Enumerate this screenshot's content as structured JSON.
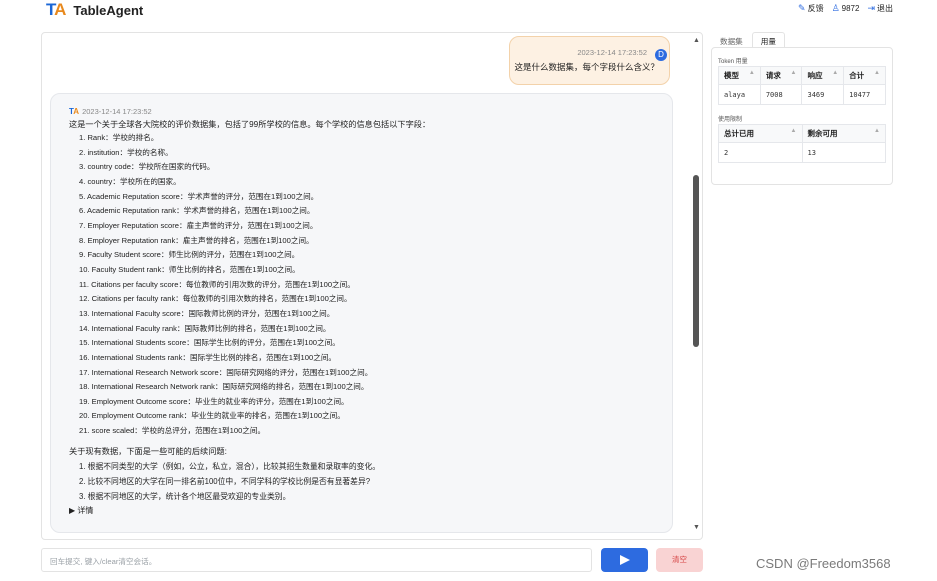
{
  "header": {
    "logo_mark": "TA",
    "app_name": "TableAgent",
    "actions": [
      {
        "label": "反馈",
        "icon": "feedback-icon"
      },
      {
        "label": "9872",
        "icon": "user-points-icon"
      },
      {
        "label": "退出",
        "icon": "logout-icon"
      }
    ]
  },
  "chat": {
    "user_message": {
      "time": "2023-12-14 17:23:52",
      "avatar": "D",
      "text": "这是什么数据集，每个字段什么含义？"
    },
    "bot_message": {
      "time": "2023-12-14 17:23:52",
      "intro": "这是一个关于全球各大院校的评价数据集，包括了99所学校的信息。每个学校的信息包括以下字段：",
      "fields": [
        "1. Rank：学校的排名。",
        "2. institution：学校的名称。",
        "3. country code：学校所在国家的代码。",
        "4. country：学校所在的国家。",
        "5. Academic Reputation score：学术声誉的评分，范围在1到100之间。",
        "6. Academic Reputation rank：学术声誉的排名，范围在1到100之间。",
        "7. Employer Reputation score：雇主声誉的评分，范围在1到100之间。",
        "8. Employer Reputation rank：雇主声誉的排名，范围在1到100之间。",
        "9. Faculty Student score：师生比例的评分，范围在1到100之间。",
        "10. Faculty Student rank：师生比例的排名，范围在1到100之间。",
        "11. Citations per faculty score：每位教师的引用次数的评分，范围在1到100之间。",
        "12. Citations per faculty rank：每位教师的引用次数的排名，范围在1到100之间。",
        "13. International Faculty score：国际教师比例的评分，范围在1到100之间。",
        "14. International Faculty rank：国际教师比例的排名，范围在1到100之间。",
        "15. International Students score：国际学生比例的评分，范围在1到100之间。",
        "16. International Students rank：国际学生比例的排名，范围在1到100之间。",
        "17. International Research Network score：国际研究网络的评分，范围在1到100之间。",
        "18. International Research Network rank：国际研究网络的排名，范围在1到100之间。",
        "19. Employment Outcome score：毕业生的就业率的评分，范围在1到100之间。",
        "20. Employment Outcome rank：毕业生的就业率的排名，范围在1到100之间。",
        "21. score scaled：学校的总评分，范围在1到100之间。"
      ],
      "followup_title": "关于现有数据，下面是一些可能的后续问题:",
      "followups": [
        "1. 根据不同类型的大学（例如，公立，私立，混合），比较其招生数量和录取率的变化。",
        "2. 比较不同地区的大学在同一排名前100位中，不同学科的学校比例是否有显著差异?",
        "3. 根据不同地区的大学，统计各个地区最受欢迎的专业类别。"
      ],
      "details_label": "▶ 详情"
    }
  },
  "input": {
    "placeholder": "回车提交, 键入/clear清空会话。",
    "clear_label": "清空"
  },
  "side_panel": {
    "tabs": [
      "数据集",
      "用量"
    ],
    "active_tab": "用量",
    "token_label": "Token 用量",
    "token_table": {
      "headers": [
        "模型",
        "请求",
        "响应",
        "合计"
      ],
      "rows": [
        [
          "alaya",
          "7008",
          "3469",
          "10477"
        ]
      ]
    },
    "limit_label": "使用限制",
    "limit_table": {
      "headers": [
        "总计已用",
        "剩余可用"
      ],
      "rows": [
        [
          "2",
          "13"
        ]
      ]
    }
  },
  "watermark": "CSDN @Freedom3568",
  "colors": {
    "brand_blue": "#2d6be0",
    "logo_orange": "#e8891d",
    "user_bubble": "#fdf1e3",
    "clear_button_bg": "#f9d3d3"
  }
}
